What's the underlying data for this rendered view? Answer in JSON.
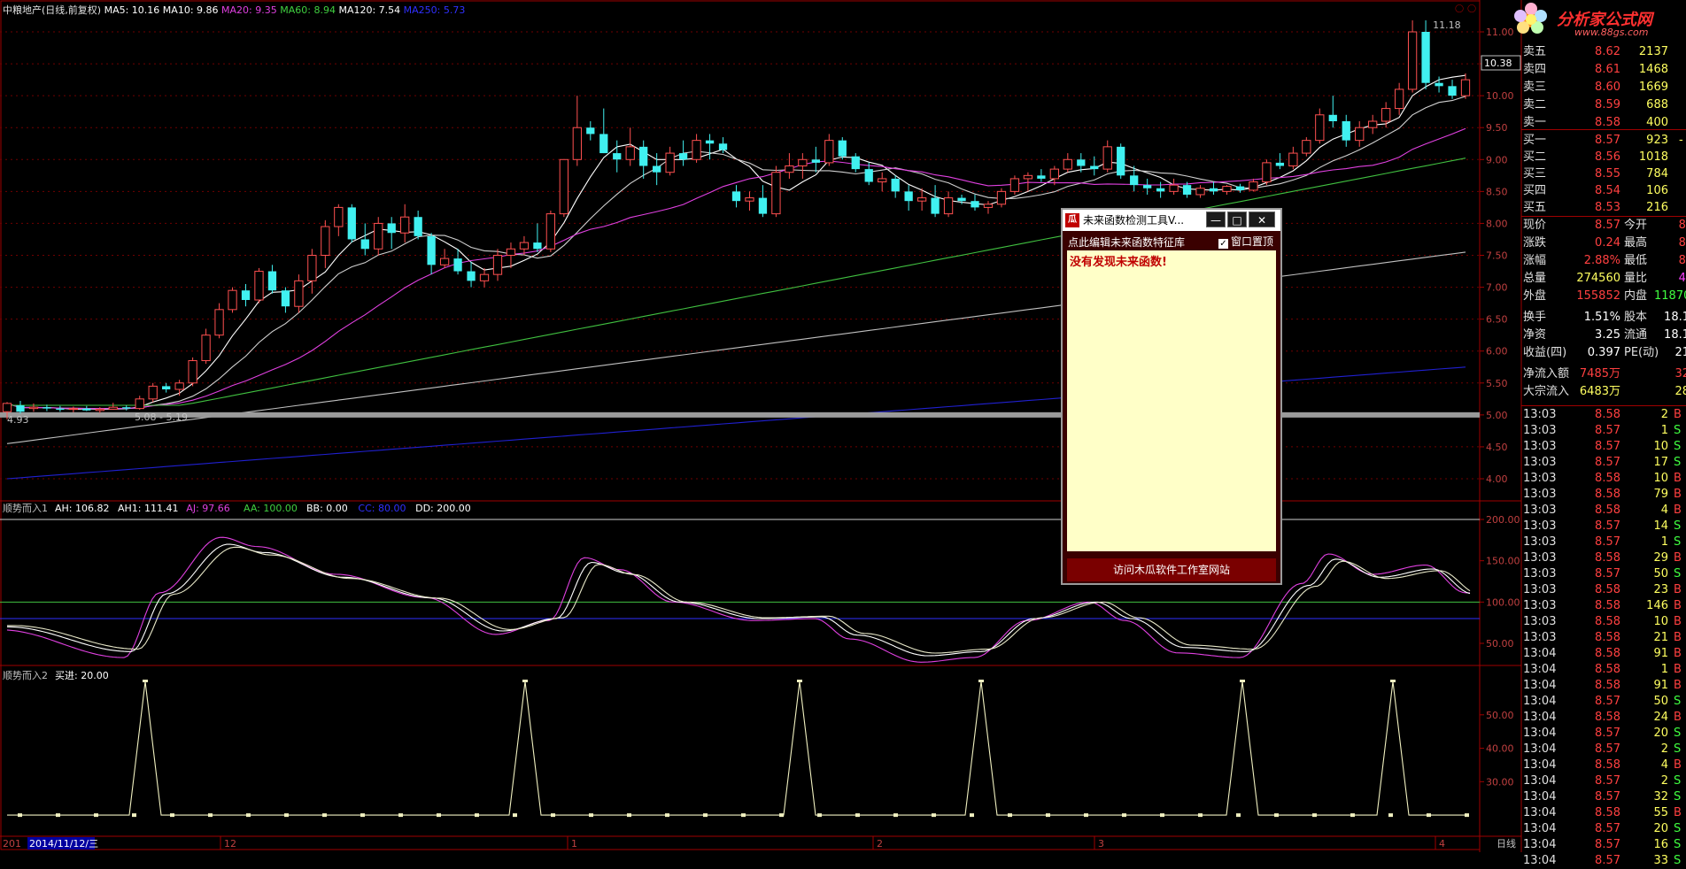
{
  "header": {
    "stock": "中粮地产(日线,前复权)",
    "ma": [
      {
        "label": "MA5: 10.16",
        "color": "#ffffff"
      },
      {
        "label": "MA10: 9.86",
        "color": "#ffffff"
      },
      {
        "label": "MA20: 9.35",
        "color": "#e040e0"
      },
      {
        "label": "MA60: 8.94",
        "color": "#40d040"
      },
      {
        "label": "MA120: 7.54",
        "color": "#ffffff"
      },
      {
        "label": "MA250: 5.73",
        "color": "#3030ff"
      }
    ]
  },
  "price_axis": [
    "11.00",
    "10.50",
    "10.00",
    "9.50",
    "9.00",
    "8.50",
    "8.00",
    "7.50",
    "7.00",
    "6.50",
    "6.00",
    "5.50",
    "5.00",
    "4.50",
    "4.00"
  ],
  "current_price_tag": "10.38",
  "annotations": {
    "high": "11.18",
    "low": "4.93",
    "range": "5.08 - 5.19"
  },
  "indicator1": {
    "title": "顺势而入1",
    "values": [
      {
        "label": "AH: 106.82",
        "color": "#ffffff"
      },
      {
        "label": "AH1: 111.41",
        "color": "#ffffff"
      },
      {
        "label": "AJ: 97.66",
        "color": "#e040e0"
      },
      {
        "label": "AA: 100.00",
        "color": "#40d040"
      },
      {
        "label": "BB: 0.00",
        "color": "#ffffff"
      },
      {
        "label": "CC: 80.00",
        "color": "#3030ff"
      },
      {
        "label": "DD: 200.00",
        "color": "#ffffff"
      }
    ],
    "axis": [
      "200.00",
      "150.00",
      "100.00",
      "50.00"
    ]
  },
  "indicator2": {
    "title": "顺势而入2",
    "value": "买进: 20.00",
    "axis": [
      "50.00",
      "40.00",
      "30.00"
    ]
  },
  "x_axis": {
    "date": "2014/11/12/三",
    "prefix": "201",
    "months": [
      "12",
      "1",
      "2",
      "3",
      "4"
    ],
    "period": "日线"
  },
  "popup": {
    "icon": "瓜",
    "title": "未来函数检测工具V...",
    "edit_link": "点此编辑未来函数特征库",
    "topmost_label": "窗口置顶",
    "message": "没有发现未来函数!",
    "footer": "访问木瓜软件工作室网站",
    "min": "—",
    "max": "□",
    "close": "✕"
  },
  "logo": {
    "text": "分析家公式网",
    "url": "www.88gs.com"
  },
  "orderbook": {
    "asks": [
      {
        "label": "卖五",
        "price": "8.62",
        "vol": "2137"
      },
      {
        "label": "卖四",
        "price": "8.61",
        "vol": "1468"
      },
      {
        "label": "卖三",
        "price": "8.60",
        "vol": "1669"
      },
      {
        "label": "卖二",
        "price": "8.59",
        "vol": "688"
      },
      {
        "label": "卖一",
        "price": "8.58",
        "vol": "400"
      }
    ],
    "bids": [
      {
        "label": "买一",
        "price": "8.57",
        "vol": "923",
        "extra": "-"
      },
      {
        "label": "买二",
        "price": "8.56",
        "vol": "1018"
      },
      {
        "label": "买三",
        "price": "8.55",
        "vol": "784"
      },
      {
        "label": "买四",
        "price": "8.54",
        "vol": "106"
      },
      {
        "label": "买五",
        "price": "8.53",
        "vol": "216"
      }
    ]
  },
  "stats": [
    {
      "l1": "现价",
      "v1": "8.57",
      "c1": "#ff4040",
      "l2": "今开",
      "v2": "8.",
      "c2": "#ff4040"
    },
    {
      "l1": "涨跌",
      "v1": "0.24",
      "c1": "#ff4040",
      "l2": "最高",
      "v2": "8.",
      "c2": "#ff4040"
    },
    {
      "l1": "涨幅",
      "v1": "2.88%",
      "c1": "#ff4040",
      "l2": "最低",
      "v2": "8.",
      "c2": "#ff4040"
    },
    {
      "l1": "总量",
      "v1": "274560",
      "c1": "#ffff60",
      "l2": "量比",
      "v2": "4.",
      "c2": "#ff40ff"
    },
    {
      "l1": "外盘",
      "v1": "155852",
      "c1": "#ff4040",
      "l2": "内盘",
      "v2": "11870",
      "c2": "#40ff40"
    },
    {
      "l1": "换手",
      "v1": "1.51%",
      "c1": "#ffffff",
      "l2": "股本",
      "v2": "18.1",
      "c2": "#ffffff"
    },
    {
      "l1": "净资",
      "v1": "3.25",
      "c1": "#ffffff",
      "l2": "流通",
      "v2": "18.1",
      "c2": "#ffffff"
    },
    {
      "l1": "收益(四)",
      "v1": "0.397",
      "c1": "#ffffff",
      "l2": "PE(动)",
      "v2": "21",
      "c2": "#ffffff"
    },
    {
      "l1": "净流入额",
      "v1": "7485万",
      "c1": "#ff4040",
      "l2": "",
      "v2": "32",
      "c2": "#ff4040"
    },
    {
      "l1": "大宗流入",
      "v1": "6483万",
      "c1": "#ffff60",
      "l2": "",
      "v2": "28",
      "c2": "#ffff60"
    }
  ],
  "ticks": [
    {
      "t": "13:03",
      "p": "8.58",
      "v": "2",
      "s": "B"
    },
    {
      "t": "13:03",
      "p": "8.57",
      "v": "1",
      "s": "S"
    },
    {
      "t": "13:03",
      "p": "8.57",
      "v": "10",
      "s": "S"
    },
    {
      "t": "13:03",
      "p": "8.57",
      "v": "17",
      "s": "S"
    },
    {
      "t": "13:03",
      "p": "8.58",
      "v": "10",
      "s": "B"
    },
    {
      "t": "13:03",
      "p": "8.58",
      "v": "79",
      "s": "B"
    },
    {
      "t": "13:03",
      "p": "8.58",
      "v": "4",
      "s": "B"
    },
    {
      "t": "13:03",
      "p": "8.57",
      "v": "14",
      "s": "S"
    },
    {
      "t": "13:03",
      "p": "8.57",
      "v": "1",
      "s": "S"
    },
    {
      "t": "13:03",
      "p": "8.58",
      "v": "29",
      "s": "B"
    },
    {
      "t": "13:03",
      "p": "8.57",
      "v": "50",
      "s": "S"
    },
    {
      "t": "13:03",
      "p": "8.58",
      "v": "23",
      "s": "B"
    },
    {
      "t": "13:03",
      "p": "8.58",
      "v": "146",
      "s": "B"
    },
    {
      "t": "13:03",
      "p": "8.58",
      "v": "10",
      "s": "B"
    },
    {
      "t": "13:03",
      "p": "8.58",
      "v": "21",
      "s": "B"
    },
    {
      "t": "13:04",
      "p": "8.58",
      "v": "91",
      "s": "B"
    },
    {
      "t": "13:04",
      "p": "8.58",
      "v": "1",
      "s": "B"
    },
    {
      "t": "13:04",
      "p": "8.58",
      "v": "91",
      "s": "B"
    },
    {
      "t": "13:04",
      "p": "8.57",
      "v": "50",
      "s": "S"
    },
    {
      "t": "13:04",
      "p": "8.58",
      "v": "24",
      "s": "B"
    },
    {
      "t": "13:04",
      "p": "8.57",
      "v": "20",
      "s": "S"
    },
    {
      "t": "13:04",
      "p": "8.57",
      "v": "2",
      "s": "S"
    },
    {
      "t": "13:04",
      "p": "8.58",
      "v": "4",
      "s": "B"
    },
    {
      "t": "13:04",
      "p": "8.57",
      "v": "2",
      "s": "S"
    },
    {
      "t": "13:04",
      "p": "8.57",
      "v": "32",
      "s": "S"
    },
    {
      "t": "13:04",
      "p": "8.58",
      "v": "55",
      "s": "B"
    },
    {
      "t": "13:04",
      "p": "8.57",
      "v": "20",
      "s": "S"
    },
    {
      "t": "13:04",
      "p": "8.57",
      "v": "16",
      "s": "S"
    },
    {
      "t": "13:04",
      "p": "8.57",
      "v": "33",
      "s": "S"
    }
  ],
  "candles": [
    [
      5.05,
      5.2,
      4.93,
      5.18
    ],
    [
      5.15,
      5.22,
      5.02,
      5.05
    ],
    [
      5.1,
      5.18,
      5.05,
      5.12
    ],
    [
      5.12,
      5.16,
      5.06,
      5.1
    ],
    [
      5.1,
      5.14,
      5.05,
      5.08
    ],
    [
      5.09,
      5.13,
      5.04,
      5.1
    ],
    [
      5.1,
      5.14,
      5.06,
      5.07
    ],
    [
      5.07,
      5.12,
      5.03,
      5.09
    ],
    [
      5.09,
      5.19,
      5.08,
      5.12
    ],
    [
      5.12,
      5.15,
      5.07,
      5.1
    ],
    [
      5.1,
      5.3,
      5.08,
      5.25
    ],
    [
      5.25,
      5.5,
      5.2,
      5.45
    ],
    [
      5.45,
      5.5,
      5.35,
      5.4
    ],
    [
      5.4,
      5.55,
      5.3,
      5.5
    ],
    [
      5.5,
      5.9,
      5.45,
      5.85
    ],
    [
      5.85,
      6.35,
      5.8,
      6.25
    ],
    [
      6.25,
      6.75,
      6.2,
      6.65
    ],
    [
      6.65,
      7.0,
      6.6,
      6.95
    ],
    [
      6.95,
      7.05,
      6.7,
      6.8
    ],
    [
      6.8,
      7.3,
      6.75,
      7.25
    ],
    [
      7.25,
      7.35,
      6.9,
      6.95
    ],
    [
      6.95,
      7.0,
      6.6,
      6.7
    ],
    [
      6.7,
      7.2,
      6.6,
      7.1
    ],
    [
      7.1,
      7.6,
      6.9,
      7.5
    ],
    [
      7.5,
      8.05,
      7.3,
      7.95
    ],
    [
      7.95,
      8.3,
      7.8,
      8.25
    ],
    [
      8.25,
      8.3,
      7.7,
      7.75
    ],
    [
      7.75,
      8.0,
      7.5,
      7.6
    ],
    [
      7.6,
      8.1,
      7.5,
      8.0
    ],
    [
      8.0,
      8.1,
      7.6,
      7.85
    ],
    [
      7.85,
      8.3,
      7.7,
      8.1
    ],
    [
      8.1,
      8.2,
      7.75,
      7.8
    ],
    [
      7.8,
      7.85,
      7.2,
      7.35
    ],
    [
      7.35,
      7.6,
      7.3,
      7.45
    ],
    [
      7.45,
      7.6,
      7.2,
      7.25
    ],
    [
      7.25,
      7.4,
      7.0,
      7.1
    ],
    [
      7.1,
      7.3,
      7.0,
      7.2
    ],
    [
      7.2,
      7.6,
      7.1,
      7.5
    ],
    [
      7.5,
      7.7,
      7.3,
      7.6
    ],
    [
      7.6,
      7.8,
      7.5,
      7.7
    ],
    [
      7.7,
      8.0,
      7.55,
      7.6
    ],
    [
      7.6,
      8.2,
      7.55,
      8.15
    ],
    [
      8.15,
      9.0,
      8.1,
      9.0
    ],
    [
      9.0,
      10.0,
      8.9,
      9.5
    ],
    [
      9.5,
      9.6,
      9.3,
      9.4
    ],
    [
      9.4,
      9.8,
      9.1,
      9.1
    ],
    [
      9.1,
      9.3,
      8.8,
      9.0
    ],
    [
      9.0,
      9.5,
      8.9,
      9.2
    ],
    [
      9.2,
      9.3,
      8.7,
      8.9
    ],
    [
      8.9,
      9.1,
      8.6,
      8.8
    ],
    [
      8.8,
      9.2,
      8.75,
      9.1
    ],
    [
      9.1,
      9.3,
      8.9,
      9.0
    ],
    [
      9.0,
      9.4,
      8.95,
      9.3
    ],
    [
      9.3,
      9.4,
      9.0,
      9.25
    ],
    [
      9.25,
      9.35,
      9.1,
      9.15
    ],
    [
      8.5,
      8.6,
      8.25,
      8.35
    ],
    [
      8.35,
      8.5,
      8.2,
      8.4
    ],
    [
      8.4,
      8.6,
      8.1,
      8.15
    ],
    [
      8.15,
      8.9,
      8.1,
      8.8
    ],
    [
      8.8,
      9.1,
      8.7,
      8.9
    ],
    [
      8.9,
      9.1,
      8.7,
      9.0
    ],
    [
      9.0,
      9.2,
      8.8,
      8.95
    ],
    [
      8.95,
      9.4,
      8.9,
      9.3
    ],
    [
      9.3,
      9.35,
      9.0,
      9.05
    ],
    [
      9.05,
      9.1,
      8.8,
      8.85
    ],
    [
      8.85,
      8.95,
      8.6,
      8.65
    ],
    [
      8.65,
      8.8,
      8.5,
      8.7
    ],
    [
      8.7,
      8.75,
      8.4,
      8.5
    ],
    [
      8.5,
      8.6,
      8.2,
      8.35
    ],
    [
      8.35,
      8.55,
      8.2,
      8.4
    ],
    [
      8.4,
      8.6,
      8.1,
      8.15
    ],
    [
      8.15,
      8.5,
      8.1,
      8.4
    ],
    [
      8.4,
      8.45,
      8.3,
      8.35
    ],
    [
      8.35,
      8.45,
      8.2,
      8.25
    ],
    [
      8.25,
      8.35,
      8.15,
      8.3
    ],
    [
      8.3,
      8.55,
      8.25,
      8.5
    ],
    [
      8.5,
      8.75,
      8.45,
      8.7
    ],
    [
      8.7,
      8.8,
      8.5,
      8.75
    ],
    [
      8.75,
      8.85,
      8.65,
      8.7
    ],
    [
      8.7,
      8.9,
      8.6,
      8.85
    ],
    [
      8.85,
      9.1,
      8.8,
      9.0
    ],
    [
      9.0,
      9.1,
      8.8,
      8.9
    ],
    [
      8.9,
      9.05,
      8.75,
      8.85
    ],
    [
      8.85,
      9.3,
      8.8,
      9.2
    ],
    [
      9.2,
      9.25,
      8.7,
      8.75
    ],
    [
      8.75,
      8.9,
      8.5,
      8.6
    ],
    [
      8.6,
      8.7,
      8.45,
      8.55
    ],
    [
      8.55,
      8.65,
      8.4,
      8.5
    ],
    [
      8.5,
      8.7,
      8.45,
      8.6
    ],
    [
      8.6,
      8.65,
      8.4,
      8.45
    ],
    [
      8.45,
      8.6,
      8.4,
      8.55
    ],
    [
      8.55,
      8.65,
      8.45,
      8.5
    ],
    [
      8.5,
      8.6,
      8.45,
      8.58
    ],
    [
      8.58,
      8.62,
      8.48,
      8.52
    ],
    [
      8.52,
      8.7,
      8.5,
      8.65
    ],
    [
      8.65,
      9.0,
      8.6,
      8.95
    ],
    [
      8.95,
      9.1,
      8.85,
      8.9
    ],
    [
      8.9,
      9.2,
      8.85,
      9.1
    ],
    [
      9.1,
      9.35,
      9.05,
      9.3
    ],
    [
      9.3,
      9.8,
      9.25,
      9.7
    ],
    [
      9.7,
      10.0,
      9.5,
      9.6
    ],
    [
      9.6,
      9.7,
      9.2,
      9.3
    ],
    [
      9.3,
      9.6,
      9.2,
      9.5
    ],
    [
      9.5,
      9.7,
      9.4,
      9.6
    ],
    [
      9.6,
      9.9,
      9.5,
      9.8
    ],
    [
      9.8,
      10.2,
      9.7,
      10.1
    ],
    [
      10.1,
      11.18,
      10.05,
      11.0
    ],
    [
      11.0,
      11.18,
      10.1,
      10.2
    ],
    [
      10.2,
      10.3,
      10.05,
      10.15
    ],
    [
      10.15,
      10.25,
      9.95,
      10.0
    ],
    [
      10.0,
      10.35,
      9.95,
      10.25
    ]
  ],
  "chart_data": {
    "type": "candlestick",
    "signal_peaks_index": [
      16,
      59,
      90,
      111,
      140,
      157
    ]
  }
}
